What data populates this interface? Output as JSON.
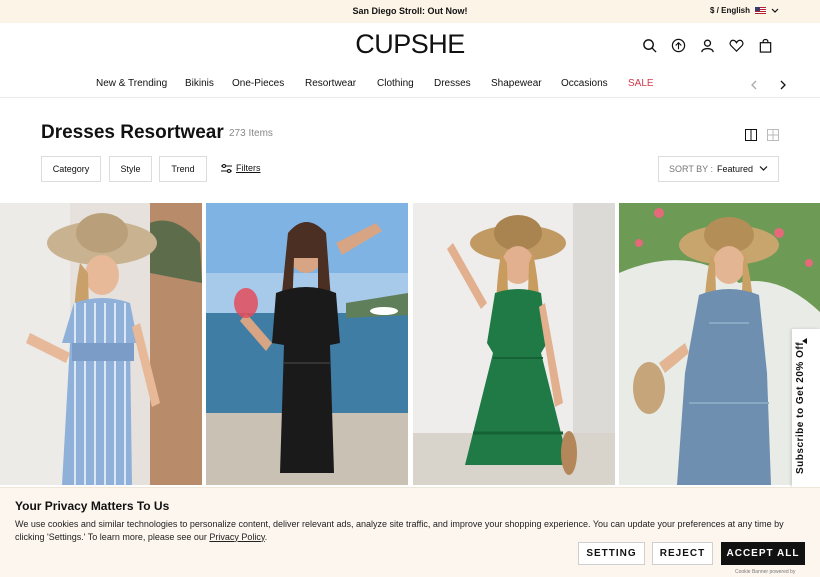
{
  "announcement": "San Diego Stroll: Out Now!",
  "locale": {
    "label": "$ / English",
    "flag": "us-flag-icon"
  },
  "brand": "CUPSHE",
  "header_icons": [
    "search-icon",
    "rewards-icon",
    "account-icon",
    "heart-icon",
    "bag-icon"
  ],
  "nav": {
    "items": [
      "New & Trending",
      "Bikinis",
      "One-Pieces",
      "Resortwear",
      "Clothing",
      "Dresses",
      "Shapewear",
      "Occasions",
      "SALE"
    ],
    "sale_color": "#d23a4a"
  },
  "page": {
    "title": "Dresses Resortwear",
    "count": "273 Items"
  },
  "filters": {
    "buttons": [
      "Category",
      "Style",
      "Trend"
    ],
    "filters_link": "Filters",
    "sort_label": "SORT BY :",
    "sort_value": "Featured"
  },
  "products": [
    {
      "name": "Blue striped button-front dress",
      "color": "#8fb0d8"
    },
    {
      "name": "Black tie-waist mini dress",
      "color": "#1a1a1a"
    },
    {
      "name": "Green ruffle hem mini dress",
      "color": "#1f7a45"
    },
    {
      "name": "Denim sleeveless shift dress",
      "color": "#6f8fb0"
    }
  ],
  "subscribe": {
    "text": "Subscribe to Get 20% Off",
    "close": "×"
  },
  "privacy": {
    "title": "Your Privacy Matters To Us",
    "text": "We use cookies and similar technologies to personalize content, deliver relevant ads, analyze site traffic, and improve your shopping experience. You can update your preferences at any time by clicking 'Settings.' To learn more, please see our",
    "policy_link": "Privacy Policy",
    "period": ".",
    "setting": "SETTING",
    "reject": "REJECT",
    "accept": "ACCEPT ALL",
    "powered": "Cookie Banner powered by"
  }
}
